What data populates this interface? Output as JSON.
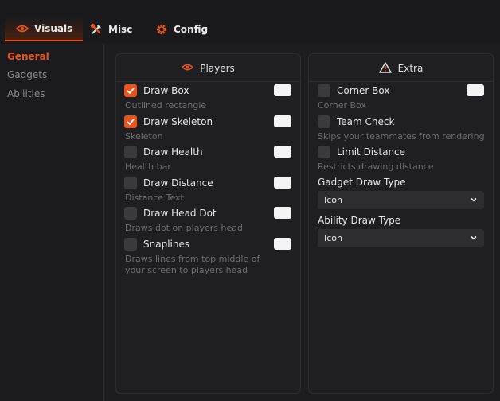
{
  "tabs": [
    {
      "label": "Visuals",
      "icon": "eye-icon",
      "active": true
    },
    {
      "label": "Misc",
      "icon": "tools-icon",
      "active": false
    },
    {
      "label": "Config",
      "icon": "gear-icon",
      "active": false
    }
  ],
  "sidebar": {
    "items": [
      {
        "label": "General",
        "active": true
      },
      {
        "label": "Gadgets",
        "active": false
      },
      {
        "label": "Abilities",
        "active": false
      }
    ]
  },
  "players": {
    "title": "Players",
    "items": [
      {
        "label": "Draw Box",
        "checked": true,
        "desc": "Outlined rectangle"
      },
      {
        "label": "Draw Skeleton",
        "checked": true,
        "desc": "Skeleton"
      },
      {
        "label": "Draw Health",
        "checked": false,
        "desc": "Health bar"
      },
      {
        "label": "Draw Distance",
        "checked": false,
        "desc": "Distance Text"
      },
      {
        "label": "Draw Head Dot",
        "checked": false,
        "desc": "Draws dot on players head"
      },
      {
        "label": "Snaplines",
        "checked": false,
        "desc_line1": "Draws lines from top middle of",
        "desc_line2": "your screen to players head"
      }
    ]
  },
  "extra": {
    "title": "Extra",
    "items": [
      {
        "label": "Corner Box",
        "checked": false,
        "desc": "Corner Box"
      },
      {
        "label": "Team Check",
        "checked": false,
        "desc": "Skips your teammates from rendering"
      },
      {
        "label": "Limit Distance",
        "checked": false,
        "desc": "Restricts drawing distance"
      }
    ],
    "gadget_label": "Gadget Draw Type",
    "gadget_value": "Icon",
    "ability_label": "Ability Draw Type",
    "ability_value": "Icon"
  },
  "colors": {
    "accent": "#e8541e",
    "swatch": "#f4f4f4"
  }
}
